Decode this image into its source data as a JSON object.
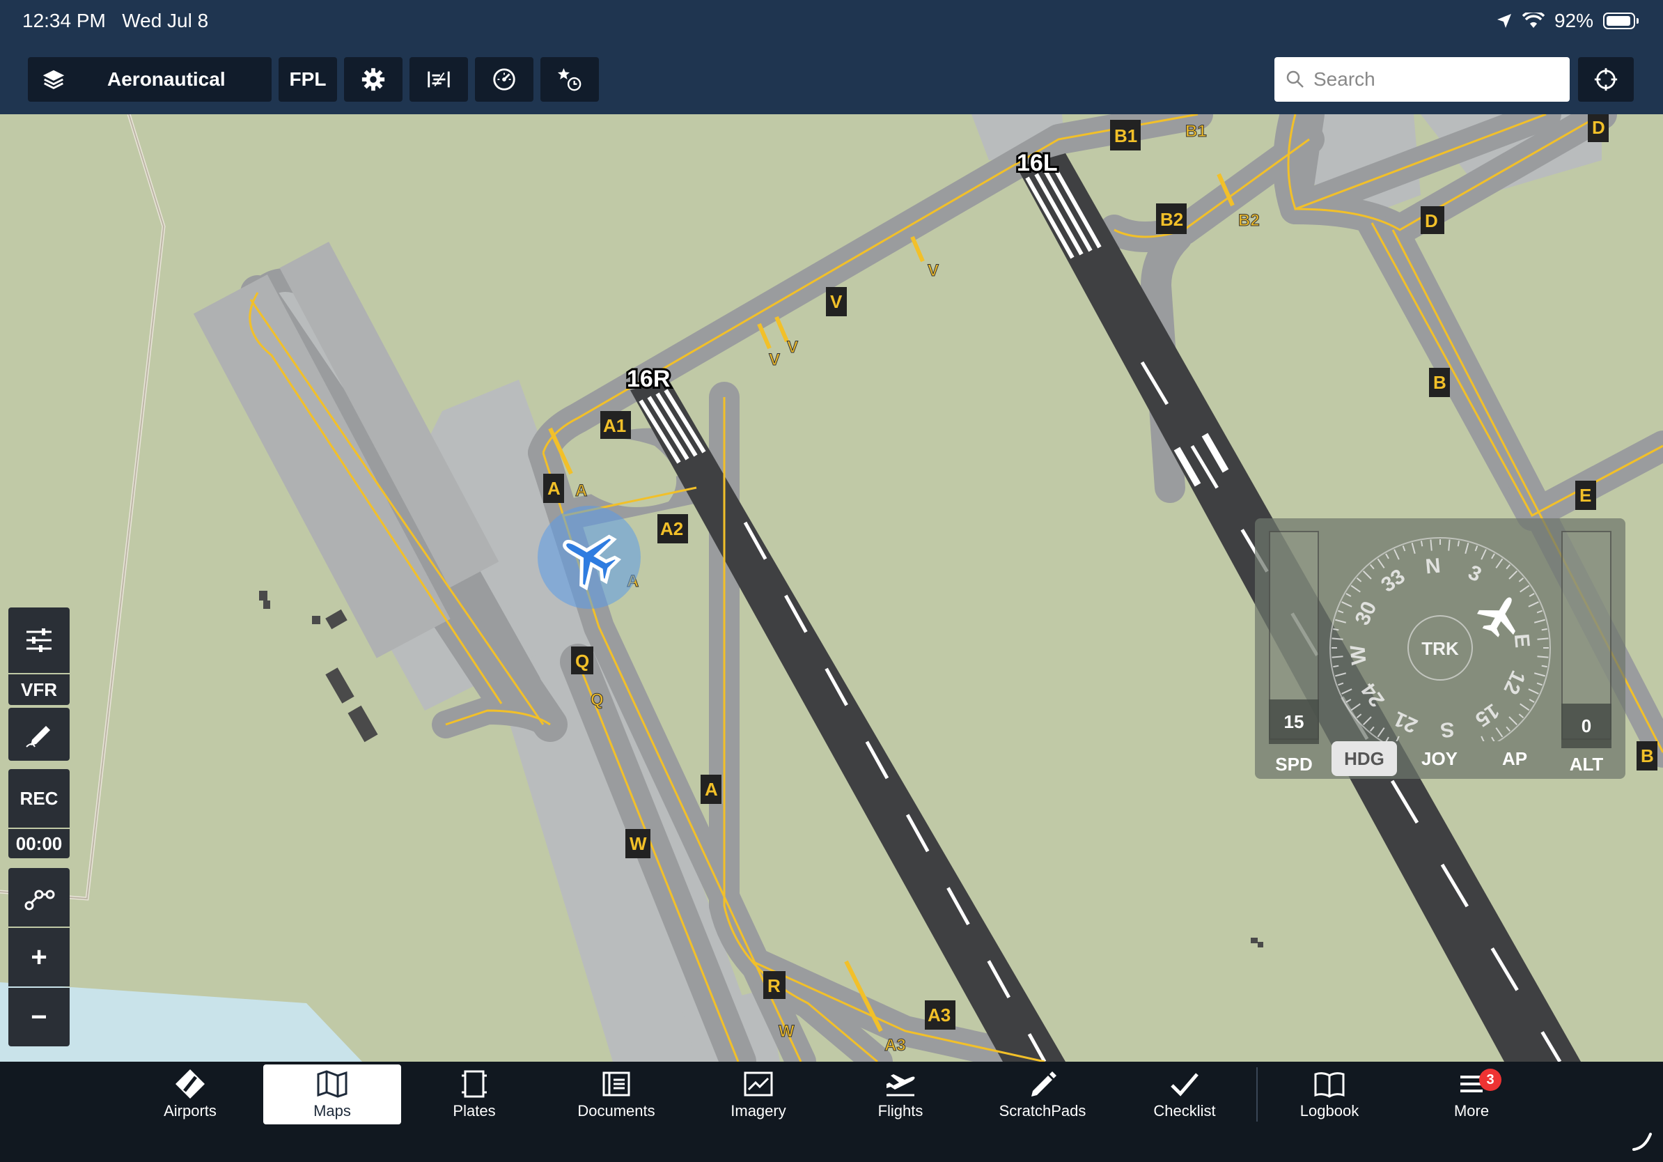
{
  "status_bar": {
    "time": "12:34 PM",
    "date": "Wed Jul 8",
    "battery": "92%"
  },
  "toolbar": {
    "layer_label": "Aeronautical",
    "fpl_label": "FPL",
    "search_placeholder": "Search"
  },
  "map": {
    "runways": [
      "16R",
      "16L"
    ],
    "taxiway_signs": [
      "B1",
      "B2",
      "D",
      "D",
      "V",
      "A1",
      "A",
      "A2",
      "Q",
      "A",
      "W",
      "R",
      "A3",
      "B",
      "E",
      "B"
    ],
    "taxiway_labels": [
      "B1",
      "B2",
      "V",
      "V",
      "V",
      "A",
      "A",
      "Q",
      "W",
      "A3"
    ]
  },
  "left_tools": {
    "vfr_label": "VFR",
    "rec_label": "REC",
    "rec_time": "00:00",
    "zoom_in": "+",
    "zoom_out": "−"
  },
  "autopilot": {
    "spd_value": "15",
    "spd_label": "SPD",
    "alt_value": "0",
    "alt_label": "ALT",
    "compass_center": "TRK",
    "compass_marks": [
      "N",
      "3",
      "E",
      "12",
      "15",
      "S",
      "21",
      "24",
      "W",
      "30",
      "33"
    ],
    "modes": [
      {
        "label": "HDG",
        "selected": true
      },
      {
        "label": "JOY",
        "selected": false
      },
      {
        "label": "AP",
        "selected": false
      }
    ]
  },
  "tabs": [
    {
      "label": "Airports",
      "icon": "airports-icon"
    },
    {
      "label": "Maps",
      "icon": "maps-icon",
      "active": true
    },
    {
      "label": "Plates",
      "icon": "plates-icon"
    },
    {
      "label": "Documents",
      "icon": "documents-icon"
    },
    {
      "label": "Imagery",
      "icon": "imagery-icon"
    },
    {
      "label": "Flights",
      "icon": "flights-icon"
    },
    {
      "label": "ScratchPads",
      "icon": "scratchpads-icon"
    },
    {
      "label": "Checklist",
      "icon": "checklist-icon"
    },
    {
      "label": "Logbook",
      "icon": "logbook-icon"
    },
    {
      "label": "More",
      "icon": "more-icon",
      "badge": "3"
    }
  ],
  "colors": {
    "toolbar_bg": "#1f3550",
    "grass": "#c0c9a6",
    "taxiway": "#9a9c9e",
    "runway": "#3f4042",
    "taxi_line": "#f2c029",
    "ownship": "#2f7ce0"
  }
}
